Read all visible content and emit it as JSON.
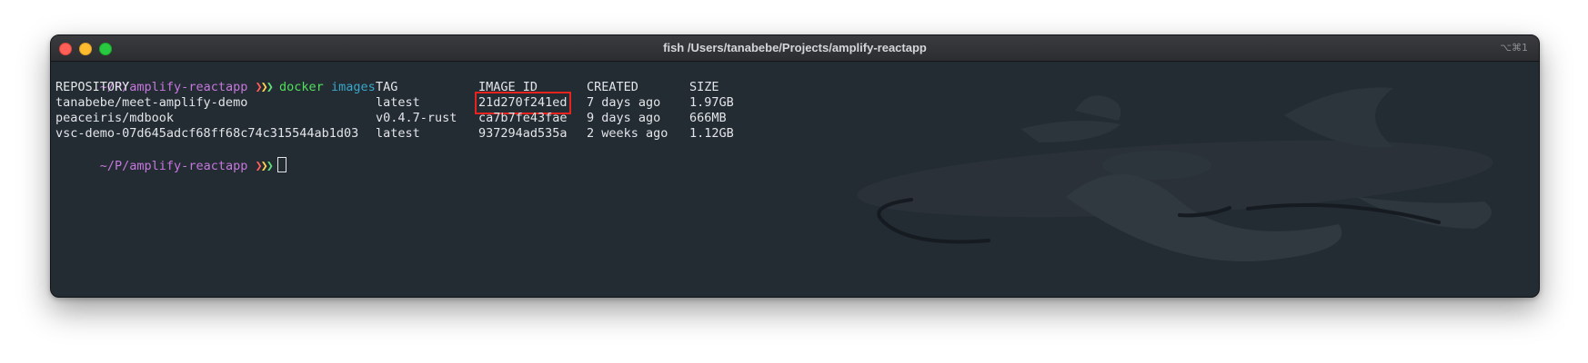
{
  "window": {
    "title": "fish /Users/tanabebe/Projects/amplify-reactapp",
    "shortcut": "⌥⌘1"
  },
  "prompt": {
    "cwd": "~/P/amplify-reactapp",
    "chevrons": "❯❯❯"
  },
  "command": {
    "name": "docker",
    "arg": "images"
  },
  "table": {
    "headers": [
      "REPOSITORY",
      "TAG",
      "IMAGE ID",
      "CREATED",
      "SIZE"
    ],
    "rows": [
      [
        "tanabebe/meet-amplify-demo",
        "latest",
        "21d270f241ed",
        "7 days ago",
        "1.97GB"
      ],
      [
        "peaceiris/mdbook",
        "v0.4.7-rust",
        "ca7b7fe43fae",
        "9 days ago",
        "666MB"
      ],
      [
        "vsc-demo-07d645adcf68ff68c74c315544ab1d03",
        "latest",
        "937294ad535a",
        "2 weeks ago",
        "1.12GB"
      ]
    ]
  },
  "colors": {
    "background": "#232b33",
    "highlight": "#e8231f"
  },
  "icons": {
    "watermark": "fish-logo-watermark"
  }
}
